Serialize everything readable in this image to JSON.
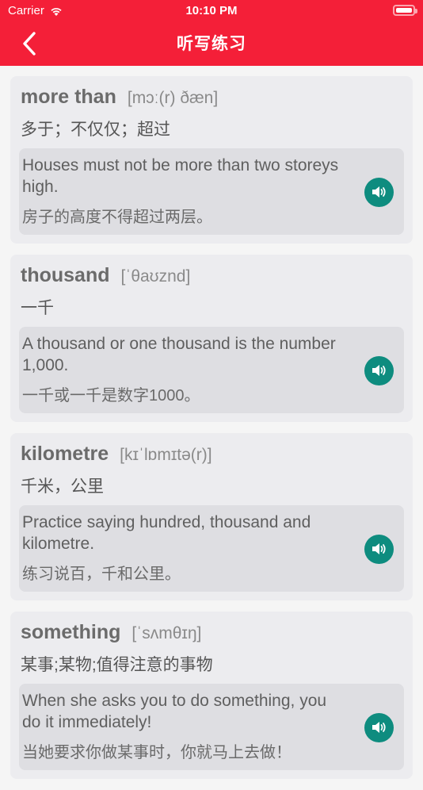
{
  "status_bar": {
    "carrier": "Carrier",
    "time": "10:10 PM"
  },
  "nav": {
    "title": "听写练习",
    "back_icon": "chevron-left-icon"
  },
  "colors": {
    "nav_bg": "#f41f38",
    "card_bg": "#ececef",
    "example_bg": "#dedee2",
    "speaker": "#0e8c7f"
  },
  "words": [
    {
      "word": "more than",
      "phonetic": "[mɔː(r) ðæn]",
      "meaning": "多于；不仅仅；超过",
      "example_en": "Houses must not be more than two storeys high.",
      "example_cn": "房子的高度不得超过两层。"
    },
    {
      "word": "thousand",
      "phonetic": "[ˈθaʊznd]",
      "meaning": "一千",
      "example_en": "A thousand or one thousand is the number 1,000.",
      "example_cn": "一千或一千是数字1000。"
    },
    {
      "word": "kilometre",
      "phonetic": "[kɪˈlɒmɪtə(r)]",
      "meaning": "千米，公里",
      "example_en": "Practice saying hundred, thousand and kilometre.",
      "example_cn": "练习说百，千和公里。"
    },
    {
      "word": "something",
      "phonetic": "[ˈsʌmθɪŋ]",
      "meaning": "某事;某物;值得注意的事物",
      "example_en": "When she asks you to do something, you do it immediately!",
      "example_cn": "当她要求你做某事时，你就马上去做！"
    }
  ]
}
